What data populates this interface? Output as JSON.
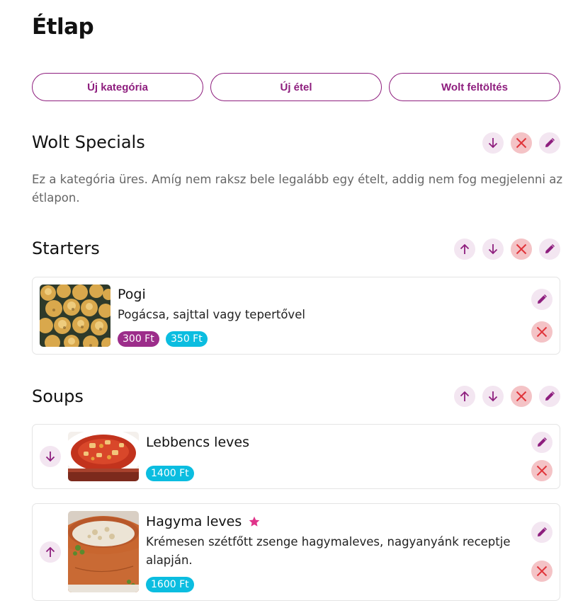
{
  "page": {
    "title": "Étlap"
  },
  "toolbar": {
    "new_category": "Új kategória",
    "new_food": "Új étel",
    "wolt_upload": "Wolt feltöltés"
  },
  "colors": {
    "brand_purple": "#8e1e7e",
    "cyan": "#0bbde0",
    "delete_red": "#e0343a",
    "light_circle": "#f3e6f1",
    "pink_circle": "#f4c3c6"
  },
  "categories": [
    {
      "name": "Wolt Specials",
      "controls": [
        "arrow-down-icon",
        "close-icon",
        "pencil-icon"
      ],
      "empty_note": "Ez a kategória üres. Amíg nem raksz bele legalább egy ételt, addig nem fog megjelenni az étlapon."
    },
    {
      "name": "Starters",
      "controls": [
        "arrow-up-icon",
        "arrow-down-icon",
        "close-icon",
        "pencil-icon"
      ],
      "items": [
        {
          "name": "Pogi",
          "description": "Pogácsa, sajttal vagy tepertővel",
          "prices": [
            "300 Ft",
            "350 Ft"
          ]
        }
      ]
    },
    {
      "name": "Soups",
      "controls": [
        "arrow-up-icon",
        "arrow-down-icon",
        "close-icon",
        "pencil-icon"
      ],
      "items": [
        {
          "name": "Lebbencs leves",
          "description": "",
          "prices": [
            "1400 Ft"
          ],
          "reorder": "arrow-down-icon"
        },
        {
          "name": "Hagyma leves",
          "featured_icon": "star-icon",
          "description": "Krémesen szétfőtt zsenge hagymaleves, nagyanyánk receptje alapján.",
          "prices": [
            "1600 Ft"
          ],
          "reorder": "arrow-up-icon"
        }
      ]
    }
  ]
}
